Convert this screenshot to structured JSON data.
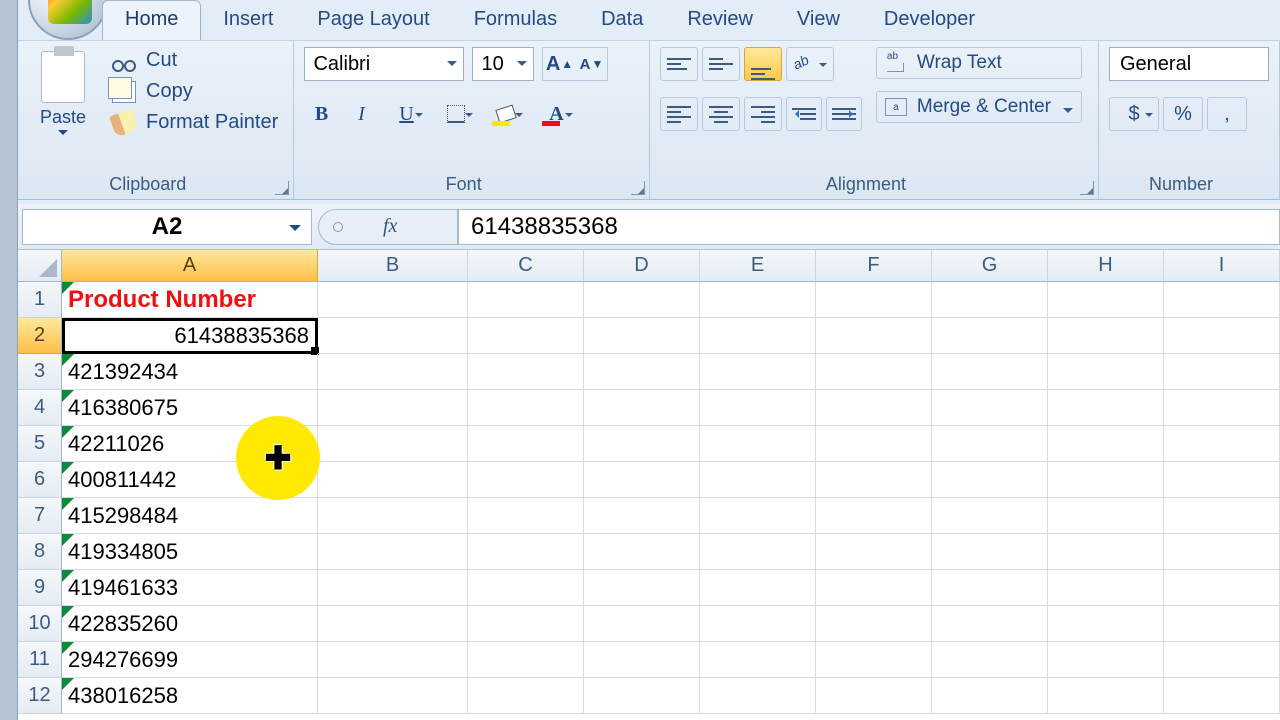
{
  "tabs": {
    "home": "Home",
    "insert": "Insert",
    "pagelayout": "Page Layout",
    "formulas": "Formulas",
    "data": "Data",
    "review": "Review",
    "view": "View",
    "developer": "Developer"
  },
  "clipboard": {
    "paste": "Paste",
    "cut": "Cut",
    "copy": "Copy",
    "formatpainter": "Format Painter",
    "label": "Clipboard"
  },
  "font": {
    "name": "Calibri",
    "size": "10",
    "label": "Font"
  },
  "alignment": {
    "wrap": "Wrap Text",
    "merge": "Merge & Center",
    "label": "Alignment"
  },
  "number": {
    "format": "General",
    "dollar": "$",
    "percent": "%",
    "comma": ",",
    "label": "Number"
  },
  "namebox": "A2",
  "fx": "fx",
  "formula": "61438835368",
  "columns": [
    "A",
    "B",
    "C",
    "D",
    "E",
    "F",
    "G",
    "H",
    "I"
  ],
  "rows": [
    "1",
    "2",
    "3",
    "4",
    "5",
    "6",
    "7",
    "8",
    "9",
    "10",
    "11",
    "12"
  ],
  "sheet": {
    "A1": "Product Number",
    "A2": "61438835368",
    "A3": "421392434",
    "A4": "416380675",
    "A5": "42211026",
    "A6": "400811442",
    "A7": "415298484",
    "A8": "419334805",
    "A9": "419461633",
    "A10": "422835260",
    "A11": "294276699",
    "A12": "438016258"
  }
}
